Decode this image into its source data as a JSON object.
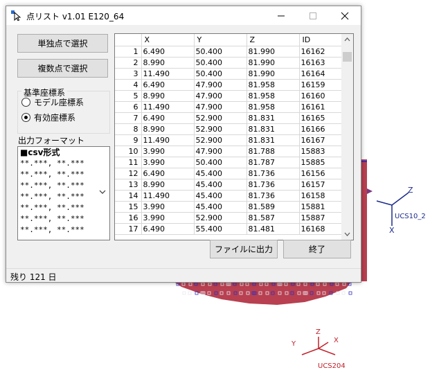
{
  "window": {
    "title": "点リスト v1.01 E120_64",
    "buttons": {
      "single": "単独点で選択",
      "multi": "複数点で選択",
      "export": "ファイルに出力",
      "quit": "終了"
    },
    "coord_group": {
      "label": "基準座標系",
      "options": [
        "モデル座標系",
        "有効座標系"
      ],
      "selected": 1
    },
    "format": {
      "label": "出力フォーマット",
      "header": "■csv形式",
      "lines": [
        "**.***, **.***",
        "**.***, **.***",
        "**.***, **.***",
        "**.***, **.***",
        "**.***, **.***",
        "**.***, **.***",
        "**.***, **.***"
      ]
    },
    "table": {
      "columns": [
        "",
        "X",
        "Y",
        "Z",
        "ID"
      ],
      "rows": [
        [
          "1",
          "6.490",
          "50.400",
          "81.990",
          "16162"
        ],
        [
          "2",
          "8.990",
          "50.400",
          "81.990",
          "16163"
        ],
        [
          "3",
          "11.490",
          "50.400",
          "81.990",
          "16164"
        ],
        [
          "4",
          "6.490",
          "47.900",
          "81.958",
          "16159"
        ],
        [
          "5",
          "8.990",
          "47.900",
          "81.958",
          "16160"
        ],
        [
          "6",
          "11.490",
          "47.900",
          "81.958",
          "16161"
        ],
        [
          "7",
          "6.490",
          "52.900",
          "81.831",
          "16165"
        ],
        [
          "8",
          "8.990",
          "52.900",
          "81.831",
          "16166"
        ],
        [
          "9",
          "11.490",
          "52.900",
          "81.831",
          "16167"
        ],
        [
          "10",
          "3.990",
          "47.900",
          "81.788",
          "15883"
        ],
        [
          "11",
          "3.990",
          "50.400",
          "81.787",
          "15885"
        ],
        [
          "12",
          "6.490",
          "45.400",
          "81.736",
          "16156"
        ],
        [
          "13",
          "8.990",
          "45.400",
          "81.736",
          "16157"
        ],
        [
          "14",
          "11.490",
          "45.400",
          "81.736",
          "16158"
        ],
        [
          "15",
          "3.990",
          "45.400",
          "81.589",
          "15881"
        ],
        [
          "16",
          "3.990",
          "52.900",
          "81.587",
          "15887"
        ],
        [
          "17",
          "6.490",
          "55.400",
          "81.481",
          "16168"
        ]
      ]
    },
    "status": "残り 121 日"
  },
  "background": {
    "ucs1_label": "UCS10_2",
    "ucs1_axes": {
      "z": "Z",
      "x": "X"
    },
    "ucs2_label": "UCS204",
    "ucs2_axes": {
      "z": "Z",
      "y": "Y",
      "x": "X"
    },
    "axis_color": "#1a2a8c",
    "ucs2_color": "#c0202a",
    "mesh_red": "#c03040",
    "mesh_blue": "#3030c0"
  }
}
